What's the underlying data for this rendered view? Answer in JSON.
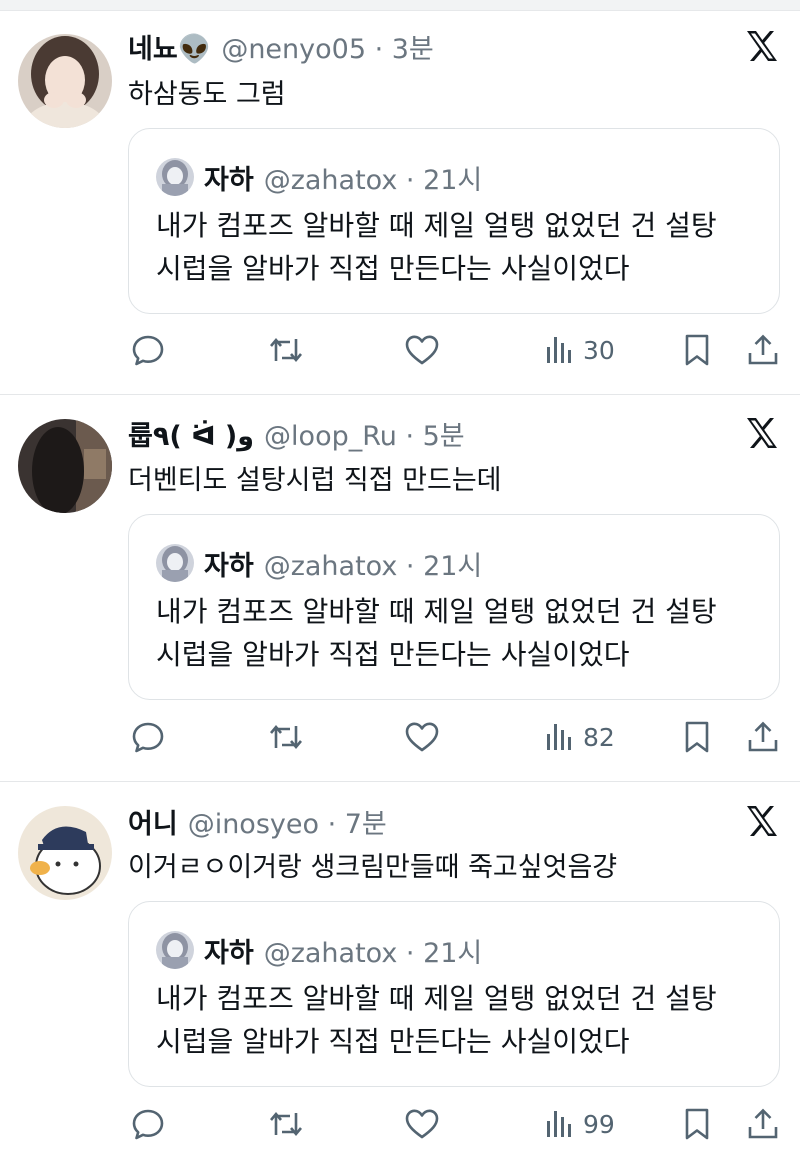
{
  "posts": [
    {
      "name": "네뇨👽",
      "handle": "@nenyo05 · 3분",
      "text": "하삼동도 그럼",
      "quote": {
        "name": "자하",
        "handle": "@zahatox · 21시",
        "line1": "내가 컴포즈 알바할 때 제일 얼탱 없었던 건 설탕",
        "line2": "시럽을 알바가 직접 만든다는 사실이었다"
      },
      "views": "30"
    },
    {
      "name": "룹٩( ᐛ )و",
      "handle": "@loop_Ru · 5분",
      "text": "더벤티도 설탕시럽 직접 만드는데",
      "quote": {
        "name": "자하",
        "handle": "@zahatox · 21시",
        "line1": "내가 컴포즈 알바할 때 제일 얼탱 없었던 건 설탕",
        "line2": "시럽을 알바가 직접 만든다는 사실이었다"
      },
      "views": "82"
    },
    {
      "name": "어니",
      "handle": "@inosyeo · 7분",
      "text": "이거ㄹㅇ이거랑 생크림만들때 죽고싶엇음걍",
      "quote": {
        "name": "자하",
        "handle": "@zahatox · 21시",
        "line1": "내가 컴포즈 알바할 때 제일 얼탱 없었던 건 설탕",
        "line2": "시럽을 알바가 직접 만든다는 사실이었다"
      },
      "views": "99"
    }
  ],
  "icons": [
    "x-logo-icon",
    "reply-icon",
    "repost-icon",
    "like-icon",
    "views-icon",
    "bookmark-icon",
    "share-icon"
  ],
  "colors": {
    "text": "#0f1419",
    "muted": "#6b7680",
    "icon": "#536471",
    "border": "#dfe3e6"
  }
}
